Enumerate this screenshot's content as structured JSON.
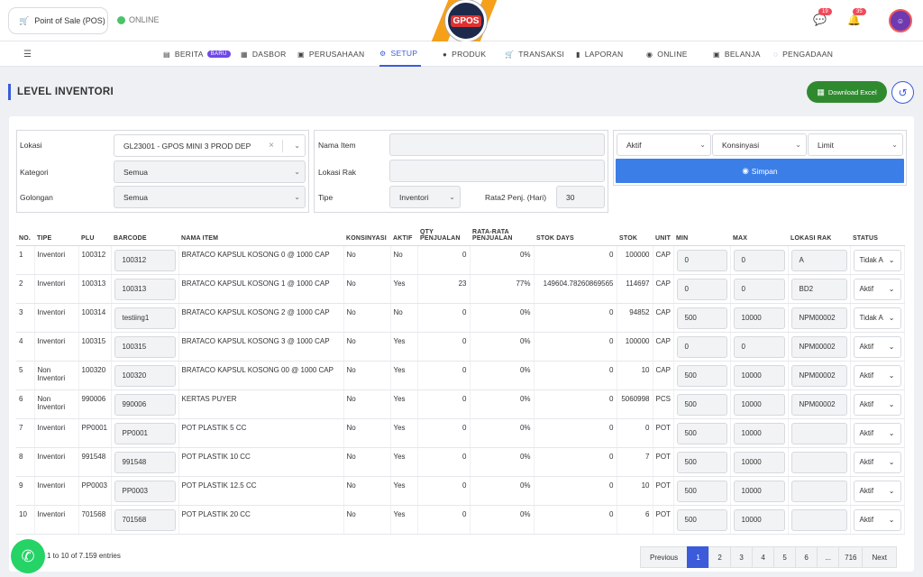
{
  "header": {
    "app_label": "Point of Sale (POS)",
    "status": "ONLINE",
    "logo_text": "GPOS",
    "notif_messages": "19",
    "notif_alerts": "35"
  },
  "nav": {
    "items": [
      {
        "label": "BERITA",
        "icon": "news-icon"
      },
      {
        "label": "DASBOR",
        "icon": "dashboard-icon"
      },
      {
        "label": "PERUSAHAAN",
        "icon": "building-icon"
      },
      {
        "label": "SETUP",
        "icon": "gear-icon"
      },
      {
        "label": "PRODUK",
        "icon": "box-icon"
      },
      {
        "label": "TRANSAKSI",
        "icon": "cart-icon"
      },
      {
        "label": "LAPORAN",
        "icon": "report-icon"
      },
      {
        "label": "ONLINE",
        "icon": "globe-icon"
      },
      {
        "label": "BELANJA",
        "icon": "bag-icon"
      },
      {
        "label": "PENGADAAN",
        "icon": "sync-icon"
      }
    ],
    "baru_badge": "BARU",
    "active": "SETUP"
  },
  "page": {
    "title": "LEVEL INVENTORI",
    "download_label": "Download Excel"
  },
  "filters": {
    "lokasi_label": "Lokasi",
    "lokasi_value": "GL23001 - GPOS MINI 3 PROD DEP",
    "kategori_label": "Kategori",
    "kategori_value": "Semua",
    "golongan_label": "Golongan",
    "golongan_value": "Semua",
    "nama_item_label": "Nama Item",
    "lokasi_rak_label": "Lokasi Rak",
    "tipe_label": "Tipe",
    "tipe_value": "Inventori",
    "rata2_label": "Rata2 Penj. (Hari)",
    "rata2_value": "30",
    "aktif_value": "Aktif",
    "konsinyasi_value": "Konsinyasi",
    "limit_value": "Limit",
    "simpan_label": "Simpan"
  },
  "table": {
    "headers": [
      "NO.",
      "TIPE",
      "PLU",
      "BARCODE",
      "NAMA ITEM",
      "KONSINYASI",
      "AKTIF",
      "QTY PENJUALAN",
      "RATA-RATA PENJUALAN",
      "STOK DAYS",
      "STOK",
      "UNIT",
      "MIN",
      "MAX",
      "LOKASI RAK",
      "STATUS"
    ],
    "rows": [
      {
        "no": "1",
        "tipe": "Inventori",
        "plu": "100312",
        "barcode": "100312",
        "nama": "BRATACO KAPSUL KOSONG 0 @ 1000 CAP",
        "konsinyasi": "No",
        "aktif": "No",
        "qty": "0",
        "rata": "0%",
        "stok_days": "0",
        "stok": "100000",
        "unit": "CAP",
        "min": "0",
        "max": "0",
        "rak": "A",
        "status": "Tidak A"
      },
      {
        "no": "2",
        "tipe": "Inventori",
        "plu": "100313",
        "barcode": "100313",
        "nama": "BRATACO KAPSUL KOSONG 1 @ 1000 CAP",
        "konsinyasi": "No",
        "aktif": "Yes",
        "qty": "23",
        "rata": "77%",
        "stok_days": "149604.78260869565",
        "stok": "114697",
        "unit": "CAP",
        "min": "0",
        "max": "0",
        "rak": "BD2",
        "status": "Aktif"
      },
      {
        "no": "3",
        "tipe": "Inventori",
        "plu": "100314",
        "barcode": "testiing1",
        "nama": "BRATACO KAPSUL KOSONG 2 @ 1000 CAP",
        "konsinyasi": "No",
        "aktif": "No",
        "qty": "0",
        "rata": "0%",
        "stok_days": "0",
        "stok": "94852",
        "unit": "CAP",
        "min": "500",
        "max": "10000",
        "rak": "NPM00002",
        "status": "Tidak A"
      },
      {
        "no": "4",
        "tipe": "Inventori",
        "plu": "100315",
        "barcode": "100315",
        "nama": "BRATACO KAPSUL KOSONG 3 @ 1000 CAP",
        "konsinyasi": "No",
        "aktif": "Yes",
        "qty": "0",
        "rata": "0%",
        "stok_days": "0",
        "stok": "100000",
        "unit": "CAP",
        "min": "0",
        "max": "0",
        "rak": "NPM00002",
        "status": "Aktif"
      },
      {
        "no": "5",
        "tipe": "Non Inventori",
        "plu": "100320",
        "barcode": "100320",
        "nama": "BRATACO KAPSUL KOSONG 00 @ 1000 CAP",
        "konsinyasi": "No",
        "aktif": "Yes",
        "qty": "0",
        "rata": "0%",
        "stok_days": "0",
        "stok": "10",
        "unit": "CAP",
        "min": "500",
        "max": "10000",
        "rak": "NPM00002",
        "status": "Aktif"
      },
      {
        "no": "6",
        "tipe": "Non Inventori",
        "plu": "990006",
        "barcode": "990006",
        "nama": "KERTAS PUYER",
        "konsinyasi": "No",
        "aktif": "Yes",
        "qty": "0",
        "rata": "0%",
        "stok_days": "0",
        "stok": "5060998",
        "unit": "PCS",
        "min": "500",
        "max": "10000",
        "rak": "NPM00002",
        "status": "Aktif"
      },
      {
        "no": "7",
        "tipe": "Inventori",
        "plu": "PP0001",
        "barcode": "PP0001",
        "nama": "POT PLASTIK 5 CC",
        "konsinyasi": "No",
        "aktif": "Yes",
        "qty": "0",
        "rata": "0%",
        "stok_days": "0",
        "stok": "0",
        "unit": "POT",
        "min": "500",
        "max": "10000",
        "rak": "",
        "status": "Aktif"
      },
      {
        "no": "8",
        "tipe": "Inventori",
        "plu": "991548",
        "barcode": "991548",
        "nama": "POT PLASTIK 10 CC",
        "konsinyasi": "No",
        "aktif": "Yes",
        "qty": "0",
        "rata": "0%",
        "stok_days": "0",
        "stok": "7",
        "unit": "POT",
        "min": "500",
        "max": "10000",
        "rak": "",
        "status": "Aktif"
      },
      {
        "no": "9",
        "tipe": "Inventori",
        "plu": "PP0003",
        "barcode": "PP0003",
        "nama": "POT PLASTIK 12.5 CC",
        "konsinyasi": "No",
        "aktif": "Yes",
        "qty": "0",
        "rata": "0%",
        "stok_days": "0",
        "stok": "10",
        "unit": "POT",
        "min": "500",
        "max": "10000",
        "rak": "",
        "status": "Aktif"
      },
      {
        "no": "10",
        "tipe": "Inventori",
        "plu": "701568",
        "barcode": "701568",
        "nama": "POT PLASTIK 20 CC",
        "konsinyasi": "No",
        "aktif": "Yes",
        "qty": "0",
        "rata": "0%",
        "stok_days": "0",
        "stok": "6",
        "unit": "POT",
        "min": "500",
        "max": "10000",
        "rak": "",
        "status": "Aktif"
      }
    ]
  },
  "footer": {
    "entries_text": "1 to 10 of 7.159 entries",
    "pages": [
      "Previous",
      "1",
      "2",
      "3",
      "4",
      "5",
      "6",
      "...",
      "716",
      "Next"
    ],
    "active_page": "1"
  }
}
